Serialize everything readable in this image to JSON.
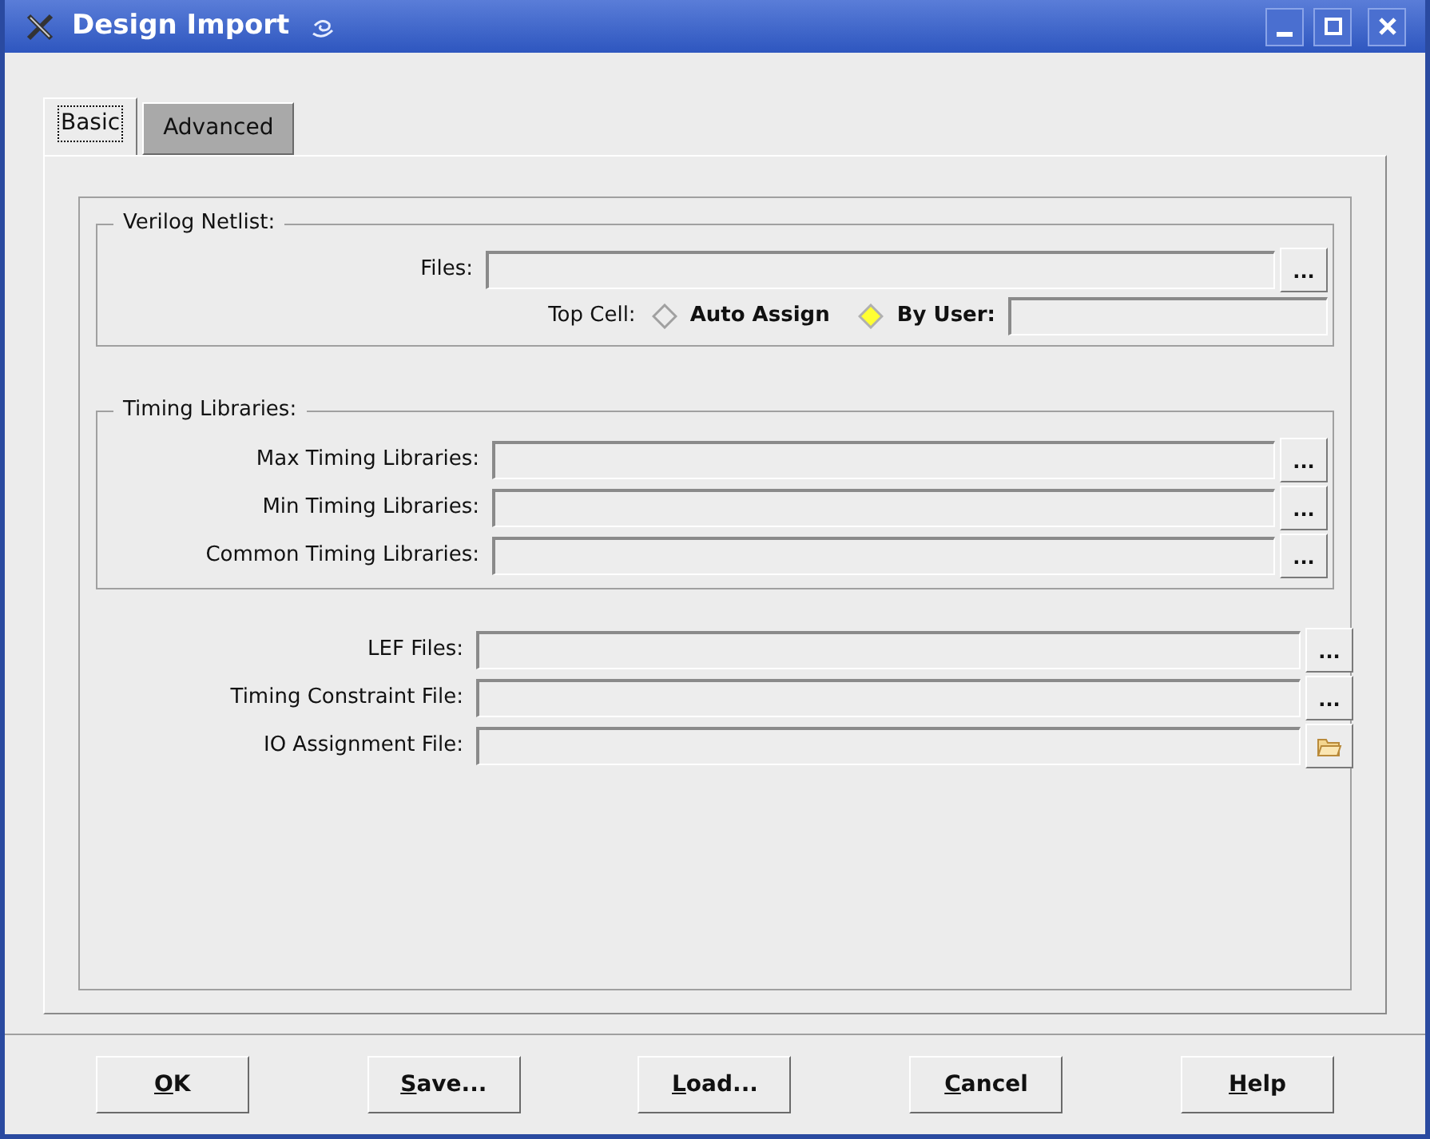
{
  "window": {
    "title": "Design Import"
  },
  "tabs": [
    {
      "label": "Basic",
      "selected": true
    },
    {
      "label": "Advanced",
      "selected": false
    }
  ],
  "verilog_netlist": {
    "title": "Verilog Netlist:",
    "files": {
      "label": "Files:",
      "button": "..."
    },
    "top_cell": {
      "label": "Top Cell:",
      "options": [
        {
          "label": "Auto Assign",
          "selected": false
        },
        {
          "label": "By User:",
          "selected": true
        }
      ]
    }
  },
  "timing_libraries": {
    "title": "Timing Libraries:",
    "fields": [
      {
        "label": "Max Timing Libraries:",
        "button": "..."
      },
      {
        "label": "Min Timing Libraries:",
        "button": "..."
      },
      {
        "label": "Common Timing Libraries:",
        "button": "..."
      }
    ]
  },
  "files": [
    {
      "label": "LEF Files:",
      "kind": "browse",
      "button": "..."
    },
    {
      "label": "Timing Constraint File:",
      "kind": "browse",
      "button": "..."
    },
    {
      "label": "IO Assignment File:",
      "kind": "folder"
    }
  ],
  "buttons": [
    {
      "label": "OK",
      "underline_first": true
    },
    {
      "label": "Save...",
      "underline_first": true
    },
    {
      "label": "Load...",
      "underline_first": true
    },
    {
      "label": "Cancel",
      "underline_first": true
    },
    {
      "label": "Help",
      "underline_first": true
    }
  ]
}
